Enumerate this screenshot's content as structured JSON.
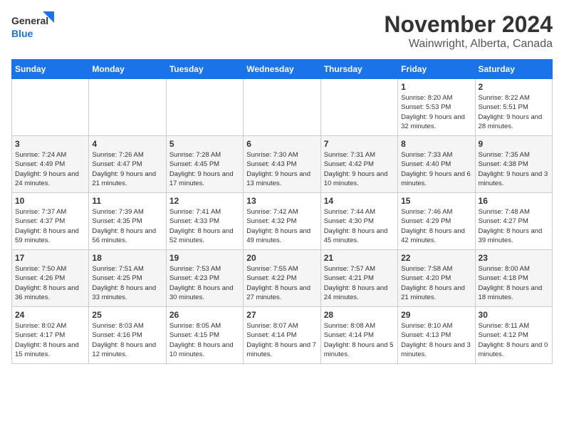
{
  "logo": {
    "line1": "General",
    "line2": "Blue"
  },
  "title": "November 2024",
  "location": "Wainwright, Alberta, Canada",
  "weekdays": [
    "Sunday",
    "Monday",
    "Tuesday",
    "Wednesday",
    "Thursday",
    "Friday",
    "Saturday"
  ],
  "weeks": [
    [
      {
        "day": "",
        "info": ""
      },
      {
        "day": "",
        "info": ""
      },
      {
        "day": "",
        "info": ""
      },
      {
        "day": "",
        "info": ""
      },
      {
        "day": "",
        "info": ""
      },
      {
        "day": "1",
        "info": "Sunrise: 8:20 AM\nSunset: 5:53 PM\nDaylight: 9 hours and 32 minutes."
      },
      {
        "day": "2",
        "info": "Sunrise: 8:22 AM\nSunset: 5:51 PM\nDaylight: 9 hours and 28 minutes."
      }
    ],
    [
      {
        "day": "3",
        "info": "Sunrise: 7:24 AM\nSunset: 4:49 PM\nDaylight: 9 hours and 24 minutes."
      },
      {
        "day": "4",
        "info": "Sunrise: 7:26 AM\nSunset: 4:47 PM\nDaylight: 9 hours and 21 minutes."
      },
      {
        "day": "5",
        "info": "Sunrise: 7:28 AM\nSunset: 4:45 PM\nDaylight: 9 hours and 17 minutes."
      },
      {
        "day": "6",
        "info": "Sunrise: 7:30 AM\nSunset: 4:43 PM\nDaylight: 9 hours and 13 minutes."
      },
      {
        "day": "7",
        "info": "Sunrise: 7:31 AM\nSunset: 4:42 PM\nDaylight: 9 hours and 10 minutes."
      },
      {
        "day": "8",
        "info": "Sunrise: 7:33 AM\nSunset: 4:40 PM\nDaylight: 9 hours and 6 minutes."
      },
      {
        "day": "9",
        "info": "Sunrise: 7:35 AM\nSunset: 4:38 PM\nDaylight: 9 hours and 3 minutes."
      }
    ],
    [
      {
        "day": "10",
        "info": "Sunrise: 7:37 AM\nSunset: 4:37 PM\nDaylight: 8 hours and 59 minutes."
      },
      {
        "day": "11",
        "info": "Sunrise: 7:39 AM\nSunset: 4:35 PM\nDaylight: 8 hours and 56 minutes."
      },
      {
        "day": "12",
        "info": "Sunrise: 7:41 AM\nSunset: 4:33 PM\nDaylight: 8 hours and 52 minutes."
      },
      {
        "day": "13",
        "info": "Sunrise: 7:42 AM\nSunset: 4:32 PM\nDaylight: 8 hours and 49 minutes."
      },
      {
        "day": "14",
        "info": "Sunrise: 7:44 AM\nSunset: 4:30 PM\nDaylight: 8 hours and 45 minutes."
      },
      {
        "day": "15",
        "info": "Sunrise: 7:46 AM\nSunset: 4:29 PM\nDaylight: 8 hours and 42 minutes."
      },
      {
        "day": "16",
        "info": "Sunrise: 7:48 AM\nSunset: 4:27 PM\nDaylight: 8 hours and 39 minutes."
      }
    ],
    [
      {
        "day": "17",
        "info": "Sunrise: 7:50 AM\nSunset: 4:26 PM\nDaylight: 8 hours and 36 minutes."
      },
      {
        "day": "18",
        "info": "Sunrise: 7:51 AM\nSunset: 4:25 PM\nDaylight: 8 hours and 33 minutes."
      },
      {
        "day": "19",
        "info": "Sunrise: 7:53 AM\nSunset: 4:23 PM\nDaylight: 8 hours and 30 minutes."
      },
      {
        "day": "20",
        "info": "Sunrise: 7:55 AM\nSunset: 4:22 PM\nDaylight: 8 hours and 27 minutes."
      },
      {
        "day": "21",
        "info": "Sunrise: 7:57 AM\nSunset: 4:21 PM\nDaylight: 8 hours and 24 minutes."
      },
      {
        "day": "22",
        "info": "Sunrise: 7:58 AM\nSunset: 4:20 PM\nDaylight: 8 hours and 21 minutes."
      },
      {
        "day": "23",
        "info": "Sunrise: 8:00 AM\nSunset: 4:18 PM\nDaylight: 8 hours and 18 minutes."
      }
    ],
    [
      {
        "day": "24",
        "info": "Sunrise: 8:02 AM\nSunset: 4:17 PM\nDaylight: 8 hours and 15 minutes."
      },
      {
        "day": "25",
        "info": "Sunrise: 8:03 AM\nSunset: 4:16 PM\nDaylight: 8 hours and 12 minutes."
      },
      {
        "day": "26",
        "info": "Sunrise: 8:05 AM\nSunset: 4:15 PM\nDaylight: 8 hours and 10 minutes."
      },
      {
        "day": "27",
        "info": "Sunrise: 8:07 AM\nSunset: 4:14 PM\nDaylight: 8 hours and 7 minutes."
      },
      {
        "day": "28",
        "info": "Sunrise: 8:08 AM\nSunset: 4:14 PM\nDaylight: 8 hours and 5 minutes."
      },
      {
        "day": "29",
        "info": "Sunrise: 8:10 AM\nSunset: 4:13 PM\nDaylight: 8 hours and 3 minutes."
      },
      {
        "day": "30",
        "info": "Sunrise: 8:11 AM\nSunset: 4:12 PM\nDaylight: 8 hours and 0 minutes."
      }
    ]
  ]
}
